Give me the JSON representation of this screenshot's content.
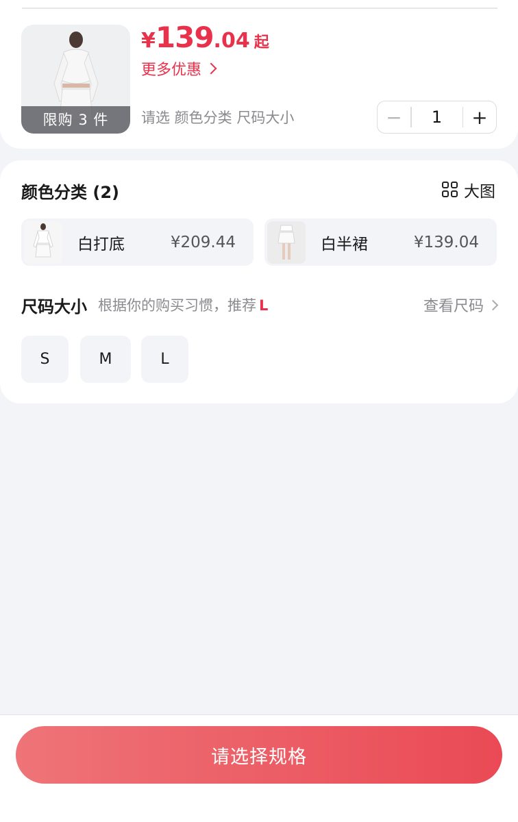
{
  "product": {
    "limit_badge": "限购 3 件",
    "price_currency": "¥",
    "price_int": "139",
    "price_dec": ".04",
    "price_suffix": "起",
    "more_deals": "更多优惠",
    "select_hint": "请选 颜色分类 尺码大小",
    "quantity": "1",
    "minus": "−",
    "plus": "+"
  },
  "color": {
    "title": "颜色分类 (2)",
    "big_view": "大图",
    "options": [
      {
        "name": "白打底",
        "price": "¥209.44"
      },
      {
        "name": "白半裙",
        "price": "¥139.04"
      }
    ]
  },
  "size": {
    "title": "尺码大小",
    "recommend_text": "根据你的购买习惯，推荐",
    "recommend_value": "L",
    "chart_link": "查看尺码",
    "options": [
      "S",
      "M",
      "L"
    ]
  },
  "cta": {
    "label": "请选择规格"
  },
  "colors": {
    "accent": "#e8324b",
    "cta_start": "#ee7478",
    "cta_end": "#ea4a55"
  }
}
